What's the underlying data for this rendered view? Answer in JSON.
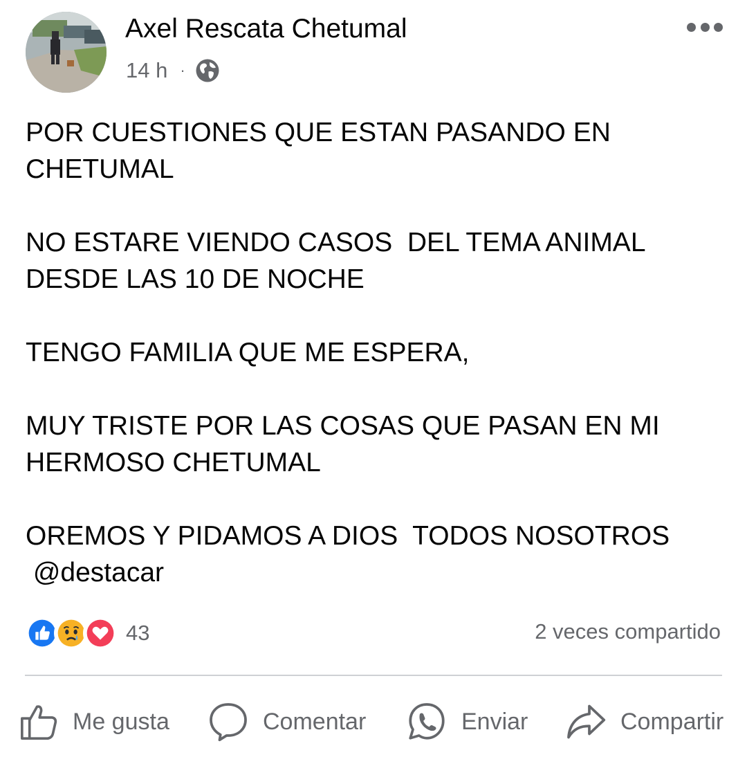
{
  "post": {
    "author": "Axel Rescata Chetumal",
    "time": "14 h",
    "separator": "·",
    "privacy_icon": "globe-icon",
    "menu_icon": "more-dots-icon",
    "paragraphs": [
      "POR CUESTIONES QUE ESTAN PASANDO EN\nCHETUMAL",
      "NO ESTARE VIENDO CASOS  DEL TEMA ANIMAL\nDESDE LAS 10 DE NOCHE",
      "TENGO FAMILIA QUE ME ESPERA,",
      "MUY TRISTE POR LAS COSAS QUE PASAN EN MI\nHERMOSO CHETUMAL",
      "OREMOS Y PIDAMOS A DIOS  TODOS NOSOTROS\n @destacar"
    ]
  },
  "reactions": {
    "icons": [
      "like-reaction-icon",
      "sad-reaction-icon",
      "love-reaction-icon"
    ],
    "count": "43",
    "shares": "2 veces compartido"
  },
  "actions": {
    "like": "Me gusta",
    "comment": "Comentar",
    "send": "Enviar",
    "share": "Compartir"
  },
  "colors": {
    "text": "#050505",
    "secondary": "#65676b",
    "like_blue": "#1877f2",
    "love_red": "#f33e58",
    "sad_yellow": "#f7b125",
    "divider": "#ced0d4"
  }
}
